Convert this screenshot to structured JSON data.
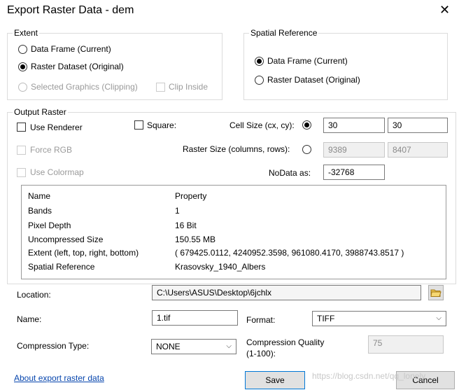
{
  "window": {
    "title": "Export Raster Data - dem",
    "close_glyph": "✕"
  },
  "extent": {
    "legend": "Extent",
    "data_frame": "Data Frame (Current)",
    "raster_dataset": "Raster Dataset (Original)",
    "selected_graphics": "Selected Graphics (Clipping)",
    "clip_inside": "Clip Inside"
  },
  "spatial_reference": {
    "legend": "Spatial Reference",
    "data_frame": "Data Frame (Current)",
    "raster_dataset": "Raster Dataset (Original)"
  },
  "output_raster": {
    "legend": "Output Raster",
    "use_renderer": "Use Renderer",
    "square": "Square:",
    "cell_size_label": "Cell Size (cx, cy):",
    "cell_size_x": "30",
    "cell_size_y": "30",
    "force_rgb": "Force RGB",
    "raster_size_label": "Raster Size (columns, rows):",
    "raster_cols": "9389",
    "raster_rows": "8407",
    "use_colormap": "Use Colormap",
    "nodata_label": "NoData as:",
    "nodata_value": "-32768"
  },
  "properties": {
    "headers": [
      "Name",
      "Property"
    ],
    "rows": [
      [
        "Bands",
        "1"
      ],
      [
        "Pixel Depth",
        "16 Bit"
      ],
      [
        "Uncompressed Size",
        "150.55 MB"
      ],
      [
        "Extent (left, top, right, bottom)",
        "( 679425.0112, 4240952.3598, 961080.4170, 3988743.8517 )"
      ],
      [
        "Spatial Reference",
        "Krasovsky_1940_Albers"
      ]
    ]
  },
  "location": {
    "label": "Location:",
    "value": "C:\\Users\\ASUS\\Desktop\\6jchlx"
  },
  "name": {
    "label": "Name:",
    "value": "1.tif"
  },
  "format": {
    "label": "Format:",
    "value": "TIFF"
  },
  "compression": {
    "type_label": "Compression Type:",
    "type_value": "NONE",
    "quality_label_line1": "Compression Quality",
    "quality_label_line2": "(1-100):",
    "quality_value": "75"
  },
  "footer": {
    "about_link": "About export raster data",
    "save": "Save",
    "cancel": "Cancel",
    "watermark": "https://blog.csdn.net/qq_lonely"
  },
  "icons": {
    "folder": "open-folder-icon",
    "chevron": "chevron-down-icon"
  }
}
